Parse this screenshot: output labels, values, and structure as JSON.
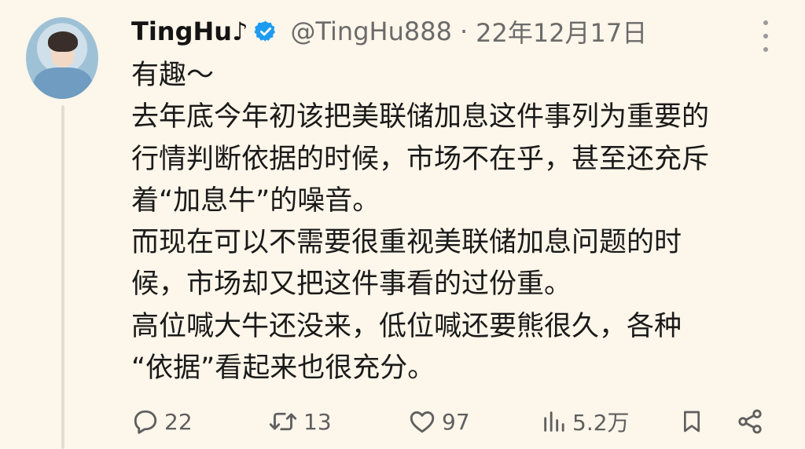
{
  "author": {
    "display_name": "TingHu♪",
    "handle": "@TingHu888",
    "separator": "·",
    "date": "22年12月17日",
    "verified": true
  },
  "body_lines": [
    "有趣～",
    "去年底今年初该把美联储加息这件事列为重要的",
    "行情判断依据的时候，市场不在乎，甚至还充斥",
    "着“加息牛”的噪音。",
    "而现在可以不需要很重视美联储加息问题的时",
    "候，市场却又把这件事看的过份重。",
    "高位喊大牛还没来，低位喊还要熊很久，各种",
    "“依据”看起来也很充分。"
  ],
  "actions": {
    "replies": "22",
    "retweets": "13",
    "likes": "97",
    "views": "5.2万"
  },
  "icons": {
    "verified": "verified-badge-icon",
    "more": "more-options-icon",
    "reply": "reply-icon",
    "retweet": "retweet-icon",
    "like": "heart-icon",
    "views": "views-icon",
    "bookmark": "bookmark-icon",
    "share": "share-icon"
  },
  "colors": {
    "background": "#fdf6ea",
    "text": "#1a1a1a",
    "meta": "#6b6b6b",
    "verified": "#1d9bf0"
  }
}
